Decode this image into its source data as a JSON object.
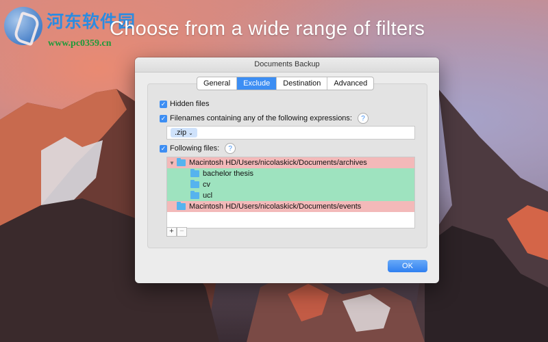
{
  "watermark": {
    "text_cn": "河东软件园",
    "url": "www.pc0359.cn"
  },
  "headline": "Choose from a wide range of filters",
  "window": {
    "title": "Documents Backup",
    "tabs": [
      {
        "label": "General",
        "active": false
      },
      {
        "label": "Exclude",
        "active": true
      },
      {
        "label": "Destination",
        "active": false
      },
      {
        "label": "Advanced",
        "active": false
      }
    ],
    "options": {
      "hidden_files": {
        "label": "Hidden files",
        "checked": true
      },
      "filenames": {
        "label": "Filenames containing any of the following expressions:",
        "checked": true
      },
      "following_files": {
        "label": "Following files:",
        "checked": true
      }
    },
    "help_symbol": "?",
    "expression_tokens": [
      ".zip"
    ],
    "file_list": [
      {
        "label": "Macintosh HD/Users/nicolaskick/Documents/archives",
        "level": 0,
        "expanded": true,
        "status": "excluded"
      },
      {
        "label": "bachelor thesis",
        "level": 1,
        "status": "included"
      },
      {
        "label": "cv",
        "level": 1,
        "status": "included"
      },
      {
        "label": "ucl",
        "level": 1,
        "status": "included"
      },
      {
        "label": "Macintosh HD/Users/nicolaskick/Documents/events",
        "level": 0,
        "expanded": false,
        "status": "excluded"
      }
    ],
    "add_symbol": "+",
    "remove_symbol": "−",
    "ok_label": "OK"
  },
  "colors": {
    "accent": "#3d8ef3",
    "excluded_row": "#f3b9b9",
    "included_row": "#9ee3bf",
    "folder": "#56b3ee"
  }
}
